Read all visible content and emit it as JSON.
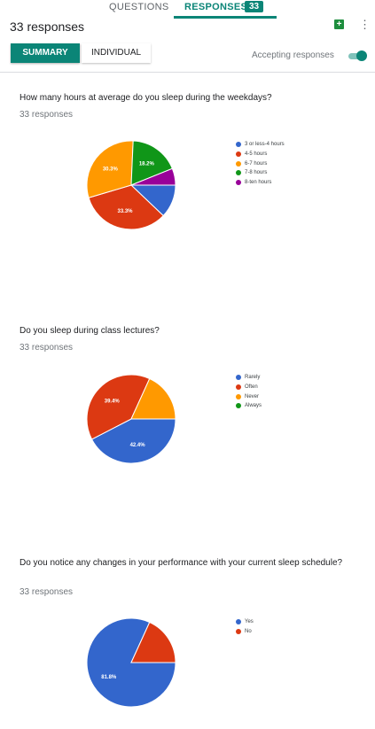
{
  "tabs": {
    "questions": "QUESTIONS",
    "responses": "RESPONSES",
    "badge": "33"
  },
  "header": {
    "response_count": "33 responses"
  },
  "buttons": {
    "summary": "SUMMARY",
    "individual": "INDIVIDUAL"
  },
  "accepting": {
    "label": "Accepting responses",
    "enabled": true
  },
  "colors": {
    "accent": "#0b8577",
    "blue": "#3366cc",
    "red": "#dc3912",
    "orange": "#ff9900",
    "green": "#109618",
    "purple": "#990099"
  },
  "icons": {
    "sheets": "sheets-icon",
    "more": "more-vert-icon"
  },
  "questions": [
    {
      "title": "How many hours at average do you sleep during the weekdays?",
      "subtitle": "33 responses",
      "chart_data": {
        "type": "pie",
        "categories": [
          "3 or less-4 hours",
          "4-5 hours",
          "6-7 hours",
          "7-8 hours",
          "8-ten hours"
        ],
        "values": [
          12.1,
          33.3,
          30.3,
          18.2,
          6.1
        ],
        "labels": [
          "",
          "33.3%",
          "30.3%",
          "18.2%",
          ""
        ],
        "colors": [
          "#3366cc",
          "#dc3912",
          "#ff9900",
          "#109618",
          "#990099"
        ]
      }
    },
    {
      "title": "Do you sleep during class lectures?",
      "subtitle": "33 responses",
      "chart_data": {
        "type": "pie",
        "categories": [
          "Rarely",
          "Often",
          "Never",
          "Always"
        ],
        "values": [
          42.4,
          39.4,
          18.2,
          0
        ],
        "labels": [
          "42.4%",
          "39.4%",
          "",
          ""
        ],
        "colors": [
          "#3366cc",
          "#dc3912",
          "#ff9900",
          "#109618"
        ]
      }
    },
    {
      "title": "Do you notice any changes in your performance with your current sleep schedule?",
      "subtitle": "33 responses",
      "chart_data": {
        "type": "pie",
        "categories": [
          "Yes",
          "No"
        ],
        "values": [
          81.8,
          18.2
        ],
        "labels": [
          "81.8%",
          ""
        ],
        "colors": [
          "#3366cc",
          "#dc3912"
        ]
      }
    }
  ]
}
